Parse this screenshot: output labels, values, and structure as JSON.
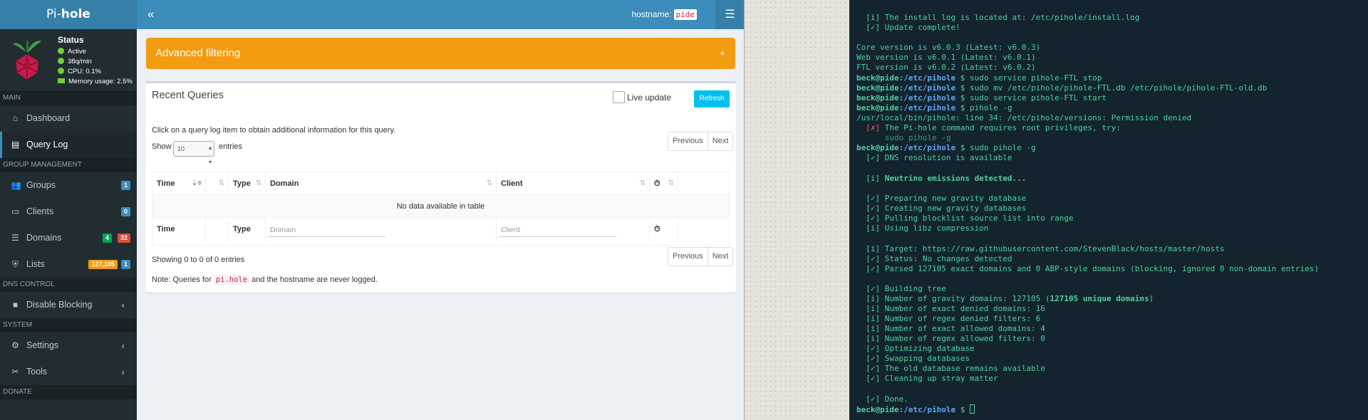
{
  "app": {
    "logo_prefix": "Pi-",
    "logo_suffix": "hole",
    "status": {
      "title": "Status",
      "active": "Active",
      "rate": "38q/min",
      "cpu": "CPU: 0.1%",
      "memory": "Memory usage: 2.5%"
    },
    "hostname_label": "hostname:",
    "hostname_value": "pide"
  },
  "sidebar": {
    "sections": {
      "main": "MAIN",
      "group": "GROUP MANAGEMENT",
      "dns": "DNS CONTROL",
      "system": "SYSTEM",
      "donate": "DONATE"
    },
    "items": [
      {
        "label": "Dashboard",
        "icon": "home-icon"
      },
      {
        "label": "Query Log",
        "icon": "file-icon"
      },
      {
        "label": "Groups",
        "icon": "users-icon",
        "badge": "1"
      },
      {
        "label": "Clients",
        "icon": "laptop-icon",
        "badge": "0"
      },
      {
        "label": "Domains",
        "icon": "list-icon",
        "badge_a": "4",
        "badge_b": "32"
      },
      {
        "label": "Lists",
        "icon": "shield-icon",
        "badge_a": "127,105",
        "badge_b": "1"
      },
      {
        "label": "Disable Blocking",
        "icon": "stop-icon"
      },
      {
        "label": "Settings",
        "icon": "cogs-icon"
      },
      {
        "label": "Tools",
        "icon": "tools-icon"
      }
    ]
  },
  "main": {
    "advanced_filtering": "Advanced filtering",
    "card_title": "Recent Queries",
    "live_update": "Live update",
    "refresh": "Refresh",
    "hint": "Click on a query log item to obtain additional information for this query.",
    "show": "Show",
    "show_value": "10",
    "entries": "entries",
    "previous": "Previous",
    "next": "Next",
    "columns": [
      "Time",
      "Type",
      "Domain",
      "Client"
    ],
    "empty": "No data available in table",
    "filter_domain_placeholder": "Domain",
    "filter_client_placeholder": "Client",
    "showing": "Showing 0 to 0 of 0 entries",
    "note_before": "Note: Queries for",
    "note_code": "pi.hole",
    "note_after": "and the hostname are never logged."
  },
  "terminal": {
    "prompt_user": "beck@pide",
    "prompt_path": ":/etc/pihole",
    "lines": [
      "  [i] The install log is located at: /etc/pihole/install.log",
      "  [✓] Update complete!",
      "",
      "Core version is v6.0.3 (Latest: v6.0.3)",
      "Web version is v6.0.1 (Latest: v6.0.1)",
      "FTL version is v6.0.2 (Latest: v6.0.2)",
      "sudo service pihole-FTL stop",
      "sudo mv /etc/pihole/pihole-FTL.db /etc/pihole/pihole-FTL-old.db",
      "sudo service pihole-FTL start",
      "pihole -g",
      "/usr/local/bin/pihole: line 34: /etc/pihole/versions: Permission denied",
      "The Pi-hole command requires root privileges, try:",
      "      sudo pihole -g",
      "sudo pihole -g",
      "  [✓] DNS resolution is available",
      "",
      "Neutrino emissions detected...",
      "",
      "  [✓] Preparing new gravity database",
      "  [✓] Creating new gravity databases",
      "  [✓] Pulling blocklist source list into range",
      "  [i] Using libz compression",
      "",
      "  [i] Target: https://raw.githubusercontent.com/StevenBlack/hosts/master/hosts",
      "  [✓] Status: No changes detected",
      "  [✓] Parsed 127105 exact domains and 0 ABP-style domains (blocking, ignored 0 non-domain entries)",
      "",
      "  [✓] Building tree",
      "  [i] Number of gravity domains: 127105 (",
      "127105 unique domains",
      ")",
      "  [i] Number of exact denied domains: 16",
      "  [i] Number of regex denied filters: 6",
      "  [i] Number of exact allowed domains: 4",
      "  [i] Number of regex allowed filters: 0",
      "  [✓] Optimizing database",
      "  [✓] Swapping databases",
      "  [✓] The old database remains available",
      "  [✓] Cleaning up stray matter",
      "",
      "  [✓] Done.",
      "$ "
    ],
    "mark_x": "[✗]",
    "mark_i": "[i]"
  },
  "colors": {
    "sidebar": "#222d32",
    "topbar": "#3c8dbc",
    "advanced": "#f39c12",
    "refresh": "#00c0ef",
    "terminal_bg": "#13242f",
    "terminal_text": "#4ed19d"
  }
}
